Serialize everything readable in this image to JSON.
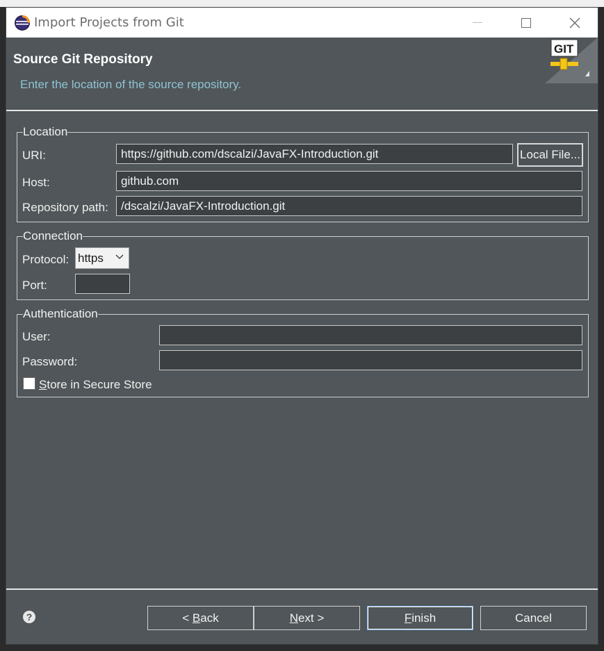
{
  "window": {
    "title": "Import Projects from Git"
  },
  "header": {
    "title": "Source Git Repository",
    "description": "Enter the location of the source repository.",
    "banner_text": "GIT"
  },
  "location": {
    "legend": "Location",
    "uri_label": "URI:",
    "uri_value": "https://github.com/dscalzi/JavaFX-Introduction.git",
    "local_file_button": "Local File...",
    "host_label": "Host:",
    "host_value": "github.com",
    "repo_path_label": "Repository path:",
    "repo_path_value": "/dscalzi/JavaFX-Introduction.git"
  },
  "connection": {
    "legend": "Connection",
    "protocol_label": "Protocol:",
    "protocol_value": "https",
    "port_label": "Port:",
    "port_value": ""
  },
  "authentication": {
    "legend": "Authentication",
    "user_label": "User:",
    "user_value": "",
    "password_label": "Password:",
    "password_value": "",
    "store_label_mnemonic": "S",
    "store_label_rest": "tore in Secure Store",
    "store_checked": false
  },
  "footer": {
    "back_prefix": "< ",
    "back_mnemonic": "B",
    "back_rest": "ack",
    "next_mnemonic": "N",
    "next_rest": "ext >",
    "finish_mnemonic": "F",
    "finish_rest": "inish",
    "cancel_label": "Cancel",
    "help_glyph": "?"
  },
  "colors": {
    "dialog_bg": "#505659",
    "field_bg": "#3c4043",
    "description_text": "#8fc3d4",
    "primary_button_border": "#7fb2e6"
  },
  "icons": [
    "eclipse-icon",
    "minimize-icon",
    "maximize-icon",
    "close-icon",
    "git-banner-icon",
    "chevron-down-icon",
    "help-icon"
  ]
}
